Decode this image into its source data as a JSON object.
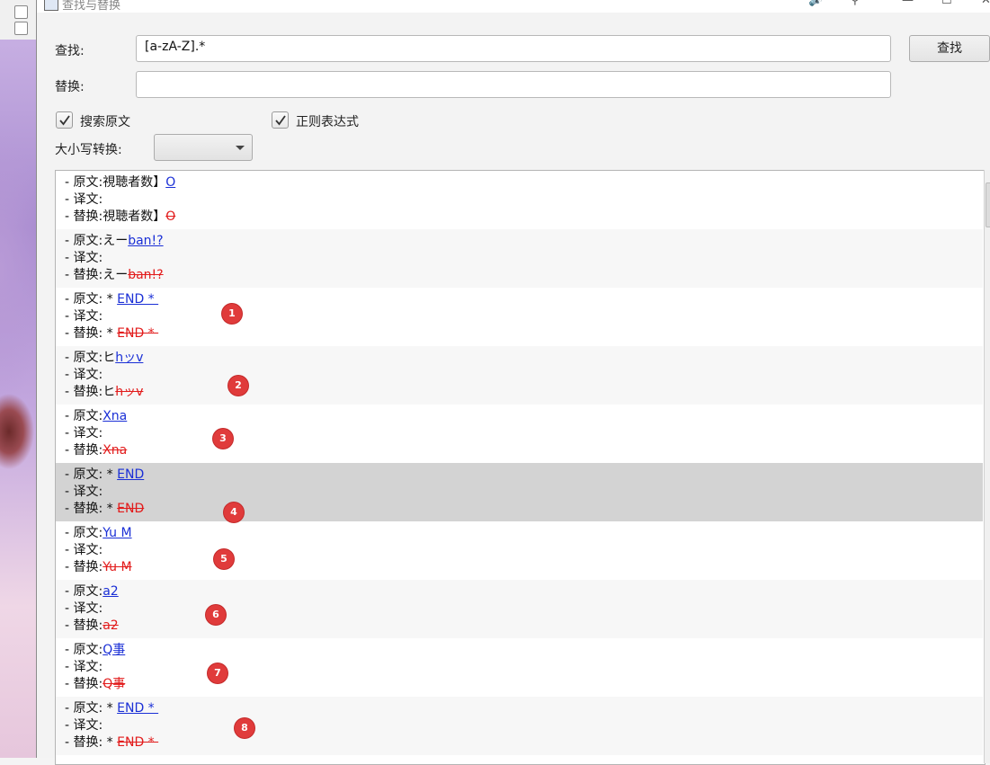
{
  "window": {
    "title": "查找与替换"
  },
  "search": {
    "find_label": "查找:",
    "find_value": "[a-zA-Z].*",
    "replace_label": "替换:",
    "replace_value": "",
    "find_button": "查找"
  },
  "options": {
    "search_original": "搜索原文",
    "regex": "正则表达式",
    "case_label": "大小写转换:"
  },
  "labels": {
    "original": "- 原文:",
    "translation": "- 译文:",
    "replace": "- 替换:"
  },
  "results": [
    {
      "prefix": "視聴者数】",
      "match": "O",
      "badge": ""
    },
    {
      "prefix": "えー",
      "match": "ban!?",
      "badge": ""
    },
    {
      "prefix": " * ",
      "match": "END * ",
      "badge": "1"
    },
    {
      "prefix": "ヒ",
      "match": "hッv",
      "badge": "2"
    },
    {
      "prefix": "",
      "match": "Xna",
      "badge": "3"
    },
    {
      "prefix": " * ",
      "match": "END",
      "badge": "4"
    },
    {
      "prefix": "",
      "match": "Yu M",
      "badge": "5"
    },
    {
      "prefix": "",
      "match": "a2",
      "badge": "6"
    },
    {
      "prefix": "",
      "match": "Q事",
      "badge": "7"
    },
    {
      "prefix": " * ",
      "match": "END * ",
      "badge": "8"
    }
  ],
  "colors": {
    "match": "#1a2fd6",
    "deleted": "#e21b1b",
    "badge": "#e03b3b",
    "selected_row": "#d3d3d3"
  }
}
